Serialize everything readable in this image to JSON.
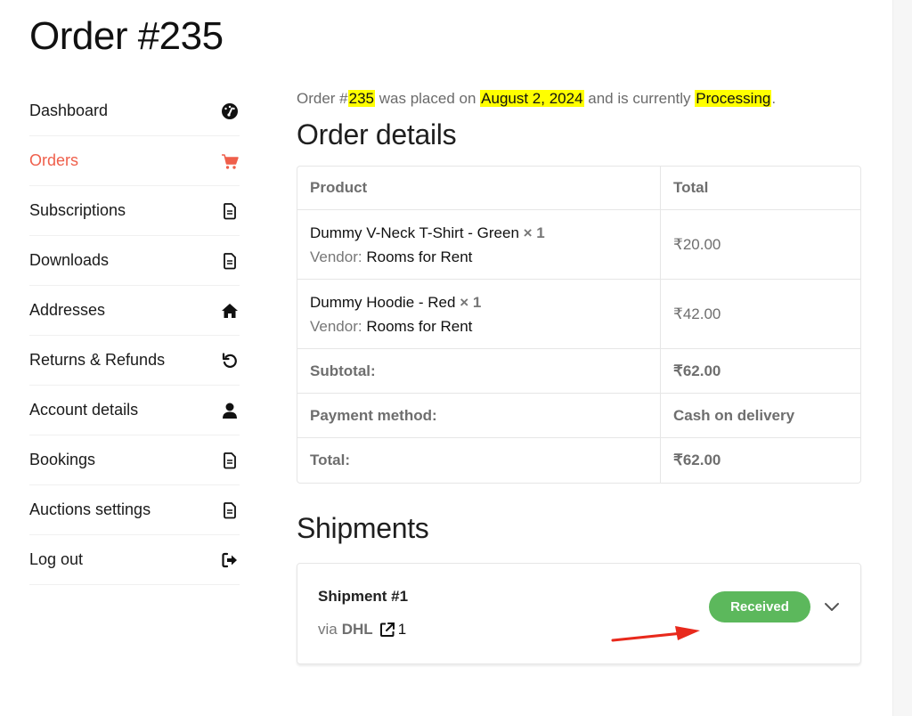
{
  "page": {
    "title": "Order #235"
  },
  "sidebar": {
    "items": [
      {
        "label": "Dashboard",
        "icon": "dashboard-gauge-icon",
        "active": false
      },
      {
        "label": "Orders",
        "icon": "cart-icon",
        "active": true
      },
      {
        "label": "Subscriptions",
        "icon": "document-icon",
        "active": false
      },
      {
        "label": "Downloads",
        "icon": "document-icon",
        "active": false
      },
      {
        "label": "Addresses",
        "icon": "home-icon",
        "active": false
      },
      {
        "label": "Returns & Refunds",
        "icon": "undo-icon",
        "active": false
      },
      {
        "label": "Account details",
        "icon": "user-icon",
        "active": false
      },
      {
        "label": "Bookings",
        "icon": "document-icon",
        "active": false
      },
      {
        "label": "Auctions settings",
        "icon": "document-icon",
        "active": false
      },
      {
        "label": "Log out",
        "icon": "logout-icon",
        "active": false
      }
    ]
  },
  "intro": {
    "prefix": "Order #",
    "order_number": "235",
    "mid1": " was placed on ",
    "date": "August 2, 2024",
    "mid2": " and is currently ",
    "status": "Processing",
    "suffix": "."
  },
  "order_details": {
    "heading": "Order details",
    "columns": [
      "Product",
      "Total"
    ],
    "items": [
      {
        "name": "Dummy V-Neck T-Shirt - Green",
        "qty": "× 1",
        "vendor_label": "Vendor:",
        "vendor": "Rooms for Rent",
        "total": "₹20.00"
      },
      {
        "name": "Dummy Hoodie - Red",
        "qty": "× 1",
        "vendor_label": "Vendor:",
        "vendor": "Rooms for Rent",
        "total": "₹42.00"
      }
    ],
    "totals": [
      {
        "label": "Subtotal:",
        "value": "₹62.00"
      },
      {
        "label": "Payment method:",
        "value": "Cash on delivery"
      },
      {
        "label": "Total:",
        "value": "₹62.00"
      }
    ]
  },
  "shipments": {
    "heading": "Shipments",
    "items": [
      {
        "name": "Shipment #1",
        "via_label": "via",
        "carrier": "DHL",
        "tracking": "1",
        "status": "Received",
        "status_color": "#5cb85c"
      }
    ]
  },
  "colors": {
    "accent": "#ef5f4b",
    "highlight": "#ffff00",
    "annotation_arrow": "#e8291c"
  }
}
